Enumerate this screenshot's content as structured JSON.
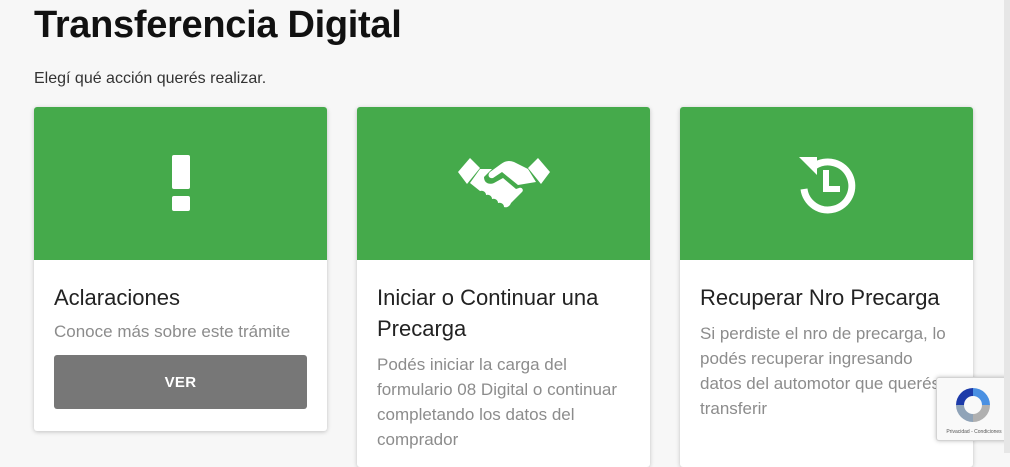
{
  "page": {
    "title": "Transferencia Digital",
    "subtitle": "Elegí qué acción querés realizar."
  },
  "cards": [
    {
      "icon": "exclamation-icon",
      "title": "Aclaraciones",
      "text": "Conoce más sobre este trámite",
      "button_label": "VER"
    },
    {
      "icon": "handshake-icon",
      "title": "Iniciar o Continuar una Precarga",
      "text": "Podés iniciar la carga del formulario 08 Digital o continuar completando los datos del comprador"
    },
    {
      "icon": "history-icon",
      "title": "Recuperar Nro Precarga",
      "text": "Si perdiste el nro de precarga, lo podés recuperar ingresando datos del automotor que querés transferir"
    }
  ],
  "recaptcha": {
    "privacy_label": "Privacidad",
    "terms_label": "Condiciones",
    "separator": "-"
  },
  "colors": {
    "accent_green": "#45aa4b",
    "button_gray": "#777777",
    "background": "#f7f7f7"
  }
}
